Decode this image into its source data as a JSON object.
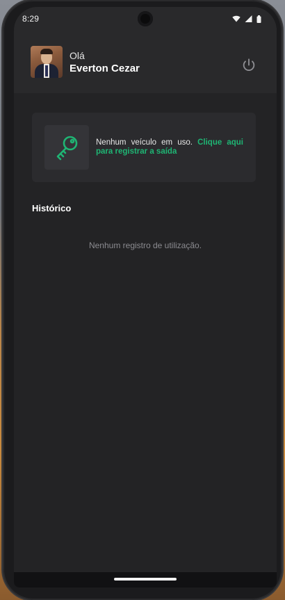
{
  "status_bar": {
    "time": "8:29",
    "icons": [
      "wifi-icon",
      "signal-icon",
      "battery-icon"
    ]
  },
  "header": {
    "greeting": "Olá",
    "user_name": "Everton Cezar",
    "logout_icon": "power-icon"
  },
  "vehicle_card": {
    "icon": "key-icon",
    "message": "Nenhum veículo em uso.",
    "link_text": "Clique aqui para registrar a saída"
  },
  "history": {
    "title": "Histórico",
    "empty_message": "Nenhum registro de utilização."
  },
  "colors": {
    "accent": "#1fb574",
    "background": "#232325",
    "header_background": "#29292b",
    "card_background": "#2b2b2e"
  }
}
